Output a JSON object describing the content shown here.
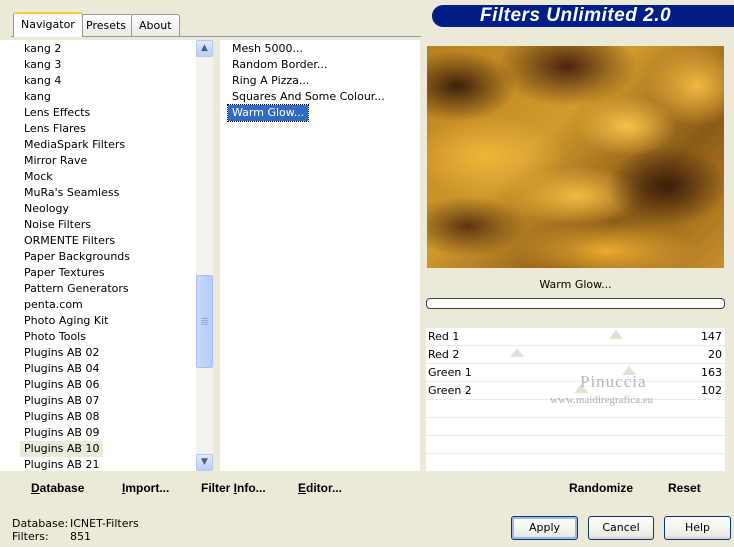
{
  "header": {
    "title": "Filters Unlimited 2.0"
  },
  "tabs": [
    {
      "label": "Navigator",
      "active": true
    },
    {
      "label": "Presets",
      "active": false
    },
    {
      "label": "About",
      "active": false
    }
  ],
  "categories": {
    "items": [
      "kang 2",
      "kang 3",
      "kang 4",
      "kang",
      "Lens Effects",
      "Lens Flares",
      "MediaSpark Filters",
      "Mirror Rave",
      "Mock",
      "MuRa's Seamless",
      "Neology",
      "Noise Filters",
      "ORMENTE Filters",
      "Paper Backgrounds",
      "Paper Textures",
      "Pattern Generators",
      "penta.com",
      "Photo Aging Kit",
      "Photo Tools",
      "Plugins AB 02",
      "Plugins AB 04",
      "Plugins AB 06",
      "Plugins AB 07",
      "Plugins AB 08",
      "Plugins AB 09",
      "Plugins AB 10",
      "Plugins AB 21"
    ],
    "selected": "Plugins AB 10"
  },
  "filters": {
    "items": [
      "Mesh 5000...",
      "Random Border...",
      "Ring A Pizza...",
      "Squares And Some Colour...",
      "Warm Glow..."
    ],
    "selected": "Warm Glow..."
  },
  "left_bar": {
    "database": {
      "underline": "D",
      "rest": "atabase"
    },
    "import": {
      "prefix": "",
      "underline": "I",
      "rest": "mport..."
    },
    "filter_info": {
      "prefix": "Filter ",
      "underline": "I",
      "rest": "nfo..."
    },
    "editor": {
      "underline": "E",
      "rest": "ditor..."
    }
  },
  "preview": {
    "filter_name": "Warm Glow..."
  },
  "params": [
    {
      "name": "Red 1",
      "value": "147",
      "level": 147
    },
    {
      "name": "Red 2",
      "value": "20",
      "level": 20
    },
    {
      "name": "Green 1",
      "value": "163",
      "level": 163
    },
    {
      "name": "Green 2",
      "value": "102",
      "level": 102
    }
  ],
  "watermark": {
    "name": "Pinuccia",
    "url": "www.maidiregrafica.eu"
  },
  "right_bar": {
    "randomize": "Randomize",
    "reset": "Reset"
  },
  "footer": {
    "database_label": "Database:",
    "database_value": "ICNET-Filters",
    "filters_label": "Filters:",
    "filters_value": "851"
  },
  "buttons": {
    "apply": "Apply",
    "cancel": "Cancel",
    "help": "Help"
  }
}
